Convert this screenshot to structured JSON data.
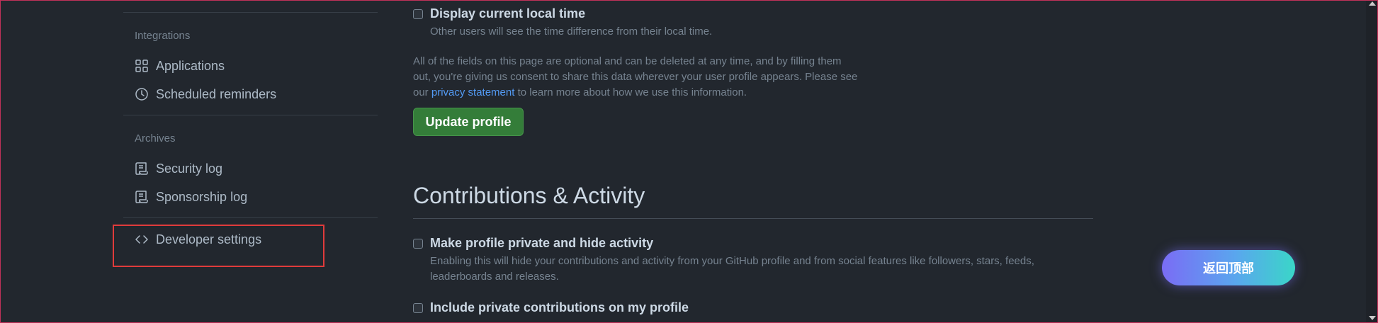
{
  "sidebar": {
    "integrations_title": "Integrations",
    "integrations": [
      {
        "label": "Applications",
        "icon": "apps-icon"
      },
      {
        "label": "Scheduled reminders",
        "icon": "clock-icon"
      }
    ],
    "archives_title": "Archives",
    "archives": [
      {
        "label": "Security log",
        "icon": "log-icon"
      },
      {
        "label": "Sponsorship log",
        "icon": "log-icon"
      }
    ],
    "developer": {
      "label": "Developer settings",
      "icon": "code-icon"
    }
  },
  "main": {
    "display_time": {
      "label": "Display current local time",
      "description": "Other users will see the time difference from their local time.",
      "checked": false
    },
    "note": {
      "before": "All of the fields on this page are optional and can be deleted at any time, and by filling them out, you're giving us consent to share this data wherever your user profile appears. Please see our",
      "link": "privacy statement",
      "after": "to learn more about how we use this information."
    },
    "update_button": "Update profile",
    "contributions_heading": "Contributions & Activity",
    "private_profile": {
      "label": "Make profile private and hide activity",
      "description": "Enabling this will hide your contributions and activity from your GitHub profile and from social features like followers, stars, feeds, leaderboards and releases.",
      "checked": false
    },
    "private_contributions": {
      "label": "Include private contributions on my profile",
      "checked": false
    }
  },
  "back_to_top": "返回顶部",
  "colors": {
    "background": "#22272e",
    "accent_link": "#539bf5",
    "button_green": "#347d39",
    "highlight_red": "#e03b3b"
  }
}
